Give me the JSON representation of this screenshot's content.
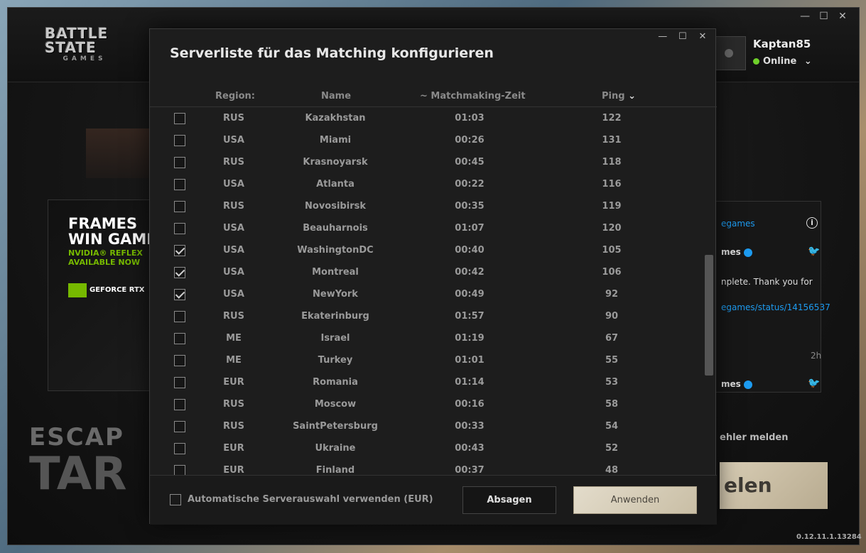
{
  "launcher": {
    "logo": {
      "line1": "BATTLE",
      "line2": "STATE",
      "line3": "GAMES"
    },
    "window_controls": [
      "—",
      "☐",
      "✕"
    ],
    "profile": {
      "username": "Kaptan85",
      "status": "Online",
      "status_color": "#6fd02a"
    },
    "ad": {
      "headline1": "FRAMES",
      "headline2": "WIN GAME",
      "sub1": "NVIDIA® REFLEX",
      "sub2": "AVAILABLE NOW",
      "badge": "GEFORCE RTX"
    },
    "game_logo": {
      "line1": "ESCAP",
      "line2": "TAR"
    },
    "news": {
      "link1": "egames",
      "author1": "mes",
      "text1": "nplete. Thank you for",
      "link2": "egames/status/14156537",
      "time": "2h",
      "author2": "mes"
    },
    "report_label": "ehler melden",
    "play_label": "elen",
    "version": "0.12.11.1.13284"
  },
  "modal": {
    "title": "Serverliste für das Matching konfigurieren",
    "window_controls": [
      "—",
      "☐",
      "✕"
    ],
    "columns": {
      "region": "Region:",
      "name": "Name",
      "matchmaking": "~ Matchmaking-Zeit",
      "ping": "Ping"
    },
    "servers": [
      {
        "checked": false,
        "region": "RUS",
        "name": "Kazakhstan",
        "time": "01:03",
        "ping": "122"
      },
      {
        "checked": false,
        "region": "USA",
        "name": "Miami",
        "time": "00:26",
        "ping": "131"
      },
      {
        "checked": false,
        "region": "RUS",
        "name": "Krasnoyarsk",
        "time": "00:45",
        "ping": "118"
      },
      {
        "checked": false,
        "region": "USA",
        "name": "Atlanta",
        "time": "00:22",
        "ping": "116"
      },
      {
        "checked": false,
        "region": "RUS",
        "name": "Novosibirsk",
        "time": "00:35",
        "ping": "119"
      },
      {
        "checked": false,
        "region": "USA",
        "name": "Beauharnois",
        "time": "01:07",
        "ping": "120"
      },
      {
        "checked": true,
        "region": "USA",
        "name": "WashingtonDC",
        "time": "00:40",
        "ping": "105"
      },
      {
        "checked": true,
        "region": "USA",
        "name": "Montreal",
        "time": "00:42",
        "ping": "106"
      },
      {
        "checked": true,
        "region": "USA",
        "name": "NewYork",
        "time": "00:49",
        "ping": "92"
      },
      {
        "checked": false,
        "region": "RUS",
        "name": "Ekaterinburg",
        "time": "01:57",
        "ping": "90"
      },
      {
        "checked": false,
        "region": "ME",
        "name": "Israel",
        "time": "01:19",
        "ping": "67"
      },
      {
        "checked": false,
        "region": "ME",
        "name": "Turkey",
        "time": "01:01",
        "ping": "55"
      },
      {
        "checked": false,
        "region": "EUR",
        "name": "Romania",
        "time": "01:14",
        "ping": "53"
      },
      {
        "checked": false,
        "region": "RUS",
        "name": "Moscow",
        "time": "00:16",
        "ping": "58"
      },
      {
        "checked": false,
        "region": "RUS",
        "name": "SaintPetersburg",
        "time": "00:33",
        "ping": "54"
      },
      {
        "checked": false,
        "region": "EUR",
        "name": "Ukraine",
        "time": "00:43",
        "ping": "52"
      },
      {
        "checked": false,
        "region": "EUR",
        "name": "Finland",
        "time": "00:37",
        "ping": "48"
      }
    ],
    "auto_select_label": "Automatische Serverauswahl verwenden (EUR)",
    "cancel_label": "Absagen",
    "apply_label": "Anwenden"
  }
}
